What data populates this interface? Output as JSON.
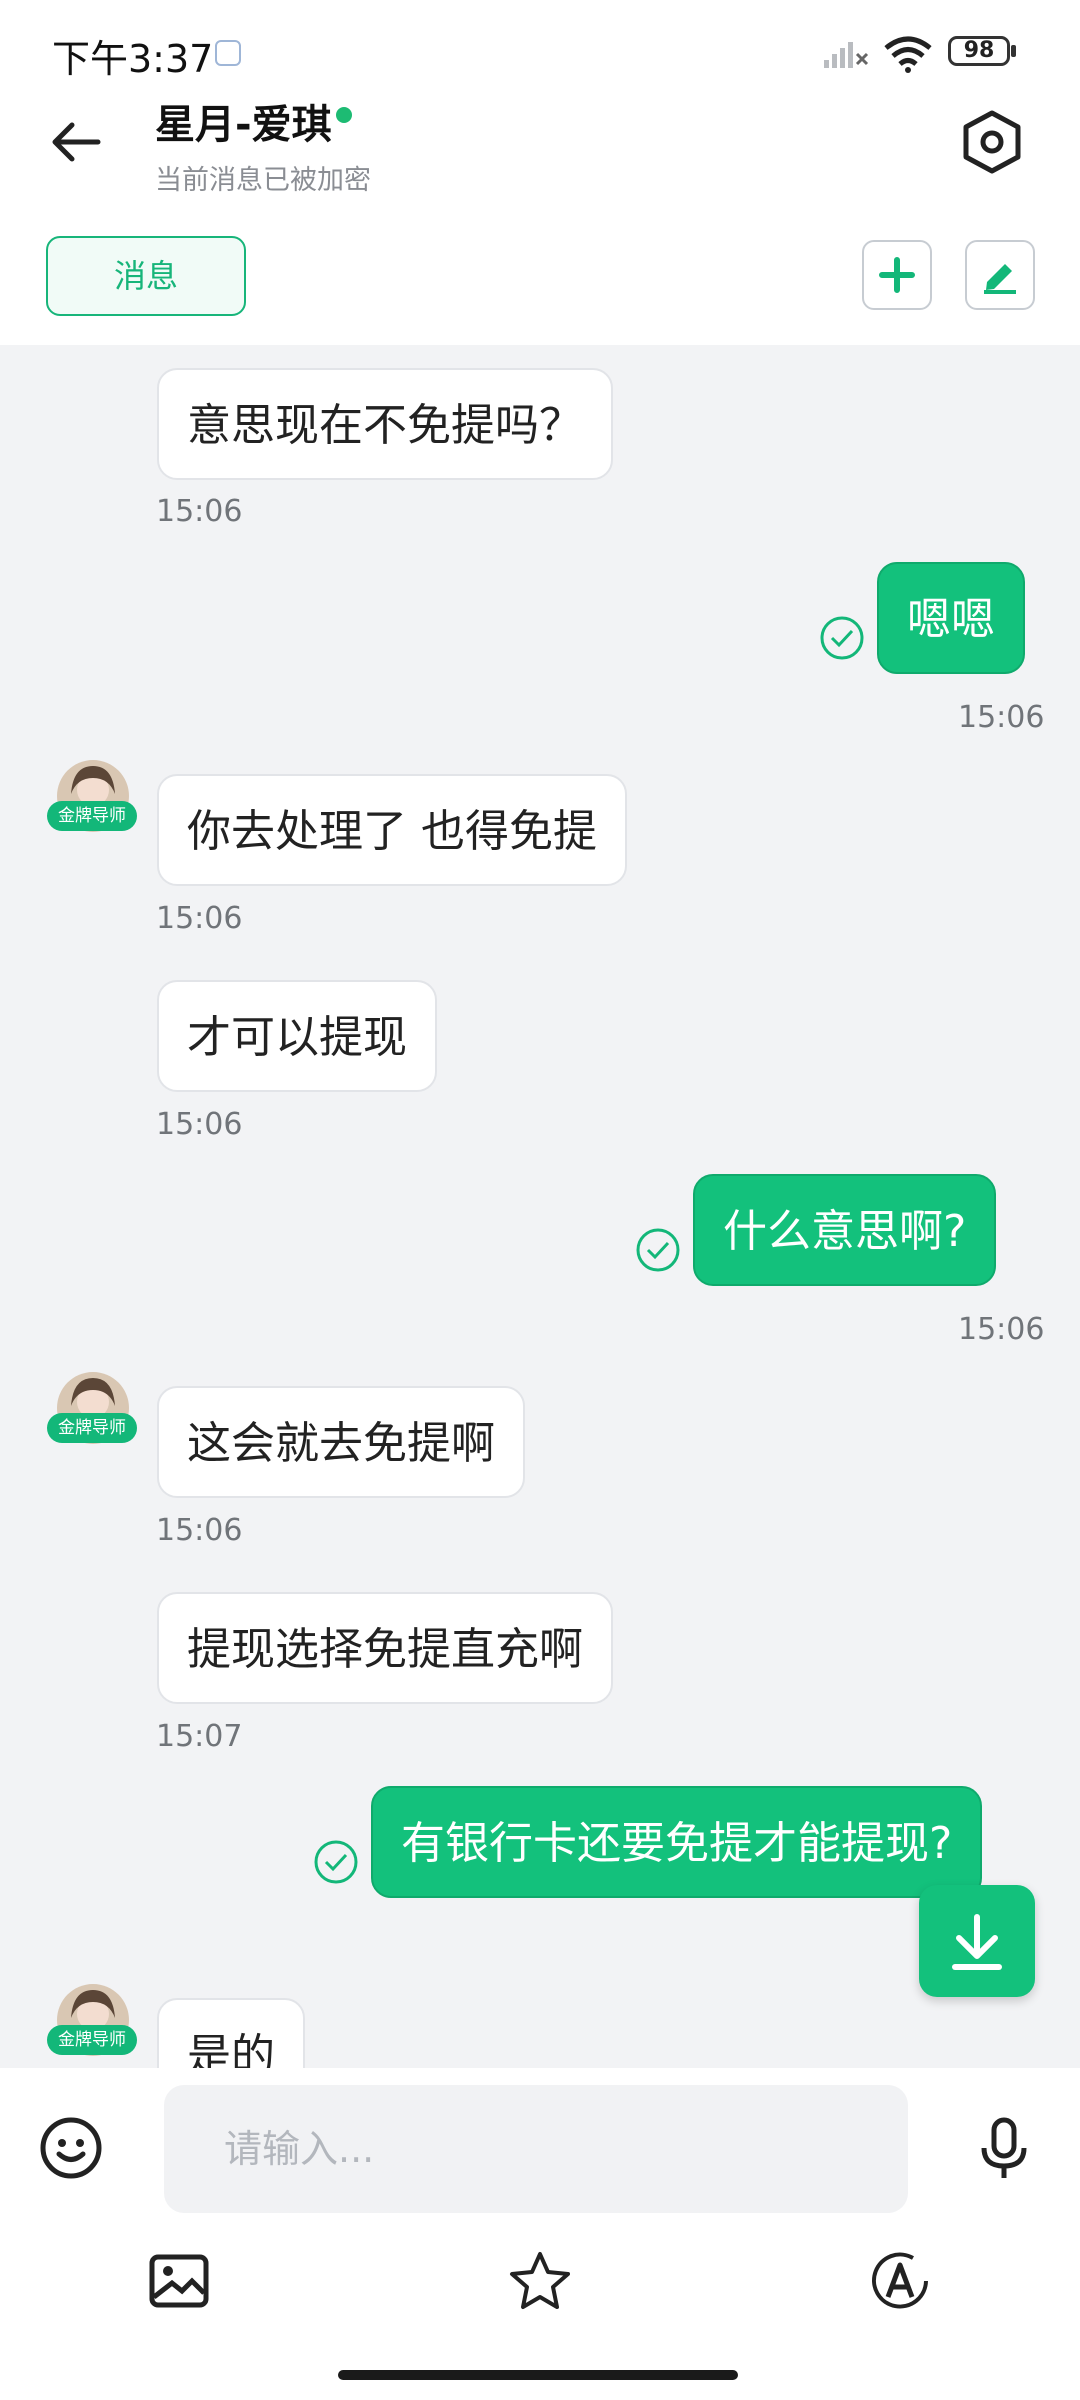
{
  "status": {
    "time": "下午3:37",
    "battery": "98"
  },
  "header": {
    "title": "星月-爱琪",
    "subtitle": "当前消息已被加密",
    "tab_label": "消息"
  },
  "messages": [
    {
      "dir": "in",
      "text": "意思现在不免提吗？",
      "time": "15:06"
    },
    {
      "dir": "out",
      "text": "嗯嗯",
      "time": "15:06"
    },
    {
      "dir": "in",
      "text": "你去处理了 也得免提",
      "time": "15:06",
      "badge": "金牌导师"
    },
    {
      "dir": "in",
      "text": "才可以提现",
      "time": "15:06"
    },
    {
      "dir": "out",
      "text": "什么意思啊?",
      "time": "15:06"
    },
    {
      "dir": "in",
      "text": "这会就去免提啊",
      "time": "15:06",
      "badge": "金牌导师"
    },
    {
      "dir": "in",
      "text": "提现选择免提直充啊",
      "time": "15:07"
    },
    {
      "dir": "out",
      "text": "有银行卡还要免提才能提现?",
      "time": ""
    },
    {
      "dir": "in",
      "text": "是的",
      "time": "",
      "badge": "金牌导师"
    }
  ],
  "composer": {
    "placeholder": "请输入..."
  },
  "icons": {
    "back": "arrow-left-icon",
    "settings": "hexagon-settings-icon",
    "add": "plus-icon",
    "edit": "pen-icon",
    "emoji": "smile-icon",
    "voice": "microphone-icon",
    "image": "image-icon",
    "favorite": "star-icon",
    "font": "font-a-icon",
    "scroll_down": "download-arrow-icon"
  },
  "colors": {
    "accent": "#13c17c",
    "background": "#f2f3f5"
  }
}
